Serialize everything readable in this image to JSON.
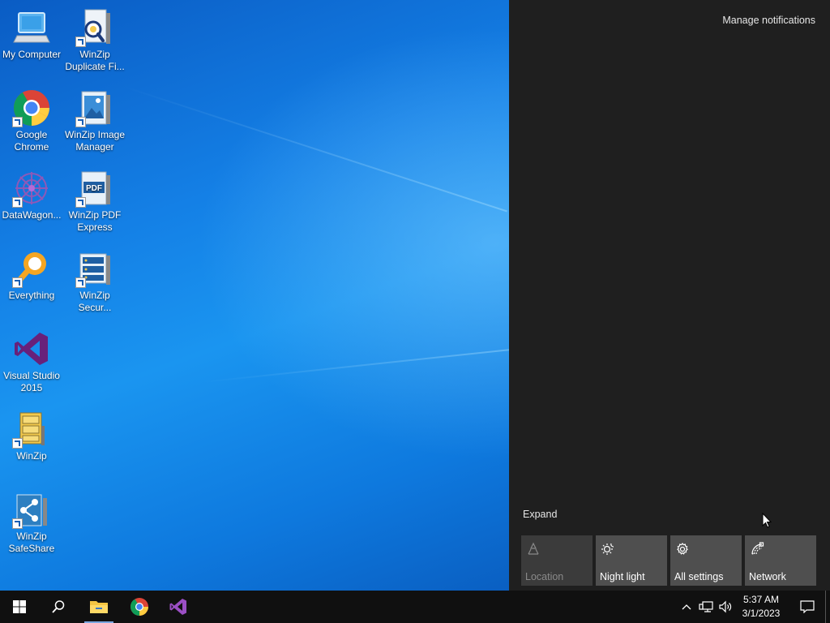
{
  "desktop": {
    "icons": [
      {
        "label": "My Computer",
        "icon": "computer-icon"
      },
      {
        "label": "WinZip Duplicate Fi...",
        "icon": "winzip-duplicate-icon"
      },
      {
        "label": "Google Chrome",
        "icon": "chrome-icon"
      },
      {
        "label": "WinZip Image Manager",
        "icon": "winzip-image-icon"
      },
      {
        "label": "DataWagon...",
        "icon": "datawagon-icon"
      },
      {
        "label": "WinZip PDF Express",
        "icon": "winzip-pdf-icon"
      },
      {
        "label": "Everything",
        "icon": "everything-icon"
      },
      {
        "label": "WinZip Secur...",
        "icon": "winzip-secure-icon"
      },
      {
        "label": "Visual Studio 2015",
        "icon": "visual-studio-icon"
      },
      {
        "label": "WinZip",
        "icon": "winzip-icon"
      },
      {
        "label": "WinZip SafeShare",
        "icon": "winzip-safeshare-icon"
      }
    ]
  },
  "action_center": {
    "manage_notifications": "Manage notifications",
    "expand": "Expand",
    "tiles": [
      {
        "label": "Location",
        "icon": "location-icon",
        "enabled": false
      },
      {
        "label": "Night light",
        "icon": "night-light-icon",
        "enabled": true
      },
      {
        "label": "All settings",
        "icon": "gear-icon",
        "enabled": true
      },
      {
        "label": "Network",
        "icon": "network-icon",
        "enabled": true
      }
    ]
  },
  "taskbar": {
    "pinned": [
      "start-icon",
      "search-icon",
      "file-explorer-icon",
      "chrome-icon",
      "visual-studio-icon"
    ],
    "clock": {
      "time": "5:37 AM",
      "date": "3/1/2023"
    }
  },
  "colors": {
    "action_center_bg": "#1f1f1f",
    "tile_bg": "#4f4f4f",
    "taskbar_bg": "#101010",
    "desktop_blue": "#1480e6"
  }
}
